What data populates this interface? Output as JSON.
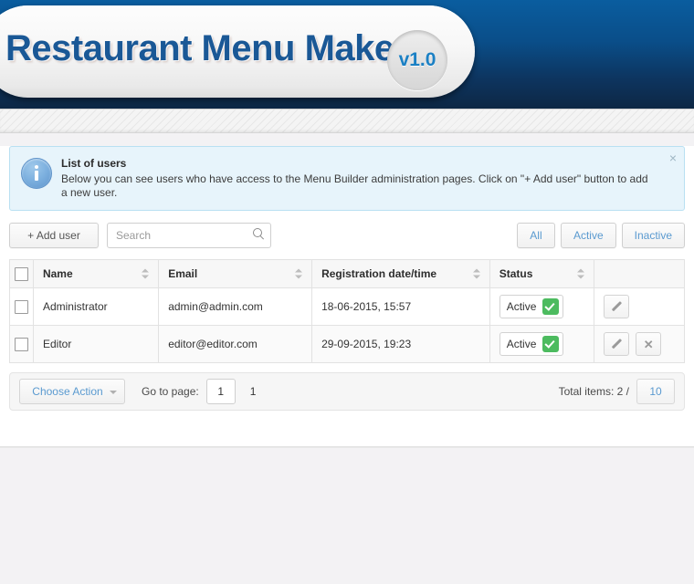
{
  "header": {
    "title": "Restaurant Menu Maker",
    "version": "v1.0"
  },
  "banner": {
    "title": "List of users",
    "text": "Below you can see users who have access to the Menu Builder administration pages. Click on \"+ Add user\" button to add a new user.",
    "close": "×"
  },
  "toolbar": {
    "add_user_label": "+ Add user",
    "search_placeholder": "Search",
    "search_value": "",
    "filters": [
      {
        "label": "All"
      },
      {
        "label": "Active"
      },
      {
        "label": "Inactive"
      }
    ]
  },
  "table": {
    "columns": [
      {
        "label": "Name"
      },
      {
        "label": "Email"
      },
      {
        "label": "Registration date/time"
      },
      {
        "label": "Status"
      }
    ],
    "rows": [
      {
        "name": "Administrator",
        "email": "admin@admin.com",
        "registration": "18-06-2015, 15:57",
        "status": "Active",
        "has_delete": false
      },
      {
        "name": "Editor",
        "email": "editor@editor.com",
        "registration": "29-09-2015, 19:23",
        "status": "Active",
        "has_delete": true
      }
    ]
  },
  "pagination": {
    "choose_action_label": "Choose Action",
    "goto_label": "Go to page:",
    "page_value": "1",
    "current_page": "1",
    "total_label": "Total items: 2 /",
    "per_page": "10"
  },
  "colors": {
    "header_top": "#0a5d9f",
    "header_bottom": "#0d2744",
    "title_blue": "#1a5896",
    "accent_link": "#5a9ad0",
    "status_green": "#4cbb5f",
    "banner_bg": "#e7f4fb",
    "banner_border": "#b9e0f2"
  }
}
